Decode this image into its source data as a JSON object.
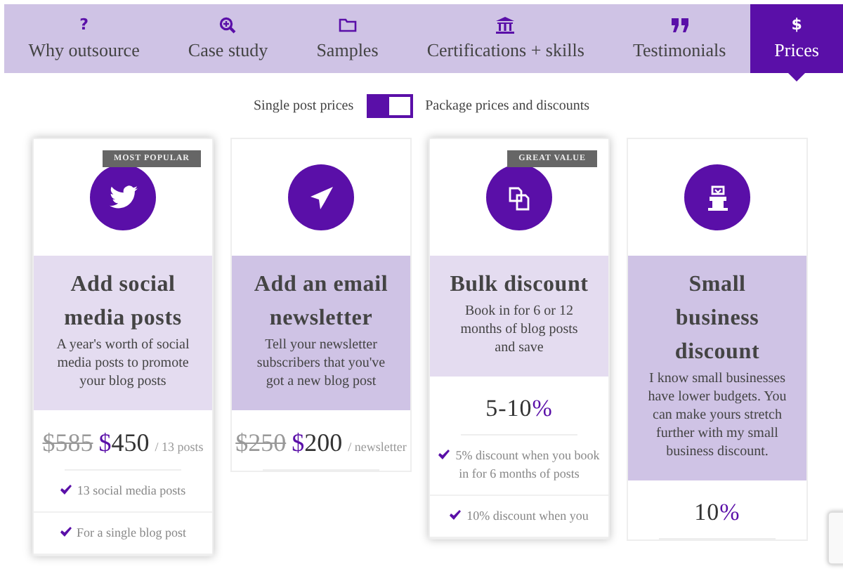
{
  "tabs": [
    {
      "label": "Why outsource",
      "selected": false,
      "glyph": "?"
    },
    {
      "label": "Case study",
      "selected": false
    },
    {
      "label": "Samples",
      "selected": false
    },
    {
      "label": "Certifications + skills",
      "selected": false
    },
    {
      "label": "Testimonials",
      "selected": false
    },
    {
      "label": "Prices",
      "selected": true,
      "glyph": "$"
    }
  ],
  "toggle": {
    "left_label": "Single post prices",
    "right_label": "Package prices and discounts",
    "on": true
  },
  "cards": [
    {
      "kind": "price",
      "badge": "MOST POPULAR",
      "featured": true,
      "title": "Add social media posts",
      "description": "A year's worth of social media posts to promote your blog posts",
      "old_price": "$585",
      "currency": "$",
      "amount": "450",
      "unit": "/ 13 posts",
      "features": [
        "13 social media posts",
        "For a single blog post"
      ]
    },
    {
      "kind": "price",
      "featured": false,
      "title": "Add an email newsletter",
      "description": "Tell your newsletter subscribers that you've got a new blog post",
      "old_price": "$250",
      "currency": "$",
      "amount": "200",
      "unit": "/ newsletter"
    },
    {
      "kind": "percent",
      "badge": "GREAT VALUE",
      "featured": true,
      "title": "Bulk discount",
      "description": "Book in for 6 or 12 months of blog posts and save",
      "amount": "5-10",
      "percent": "%",
      "features": [
        "5% discount when you book in for 6 months of posts",
        "10% discount when you"
      ]
    },
    {
      "kind": "percent",
      "featured": false,
      "title": "Small business discount",
      "description": "I know small businesses have lower budgets. You can make yours stretch further with my small business discount.",
      "amount": "10",
      "percent": "%"
    }
  ]
}
